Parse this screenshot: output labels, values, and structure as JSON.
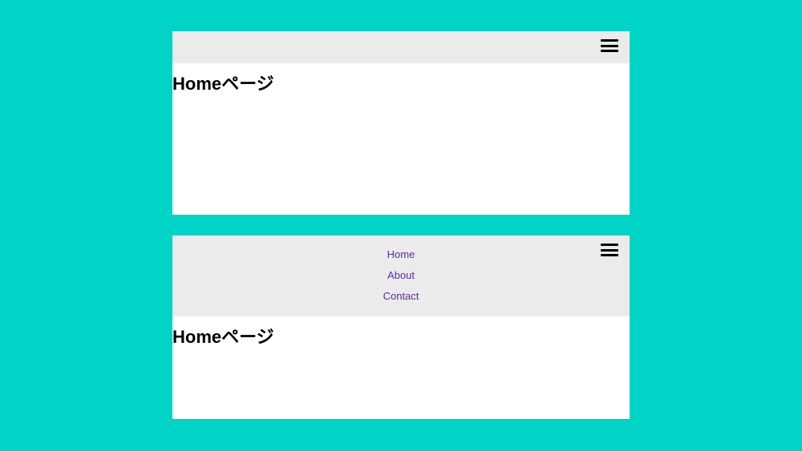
{
  "panel1": {
    "title": "Homeページ"
  },
  "panel2": {
    "title": "Homeページ",
    "menu": {
      "item0": "Home",
      "item1": "About",
      "item2": "Contact"
    }
  }
}
